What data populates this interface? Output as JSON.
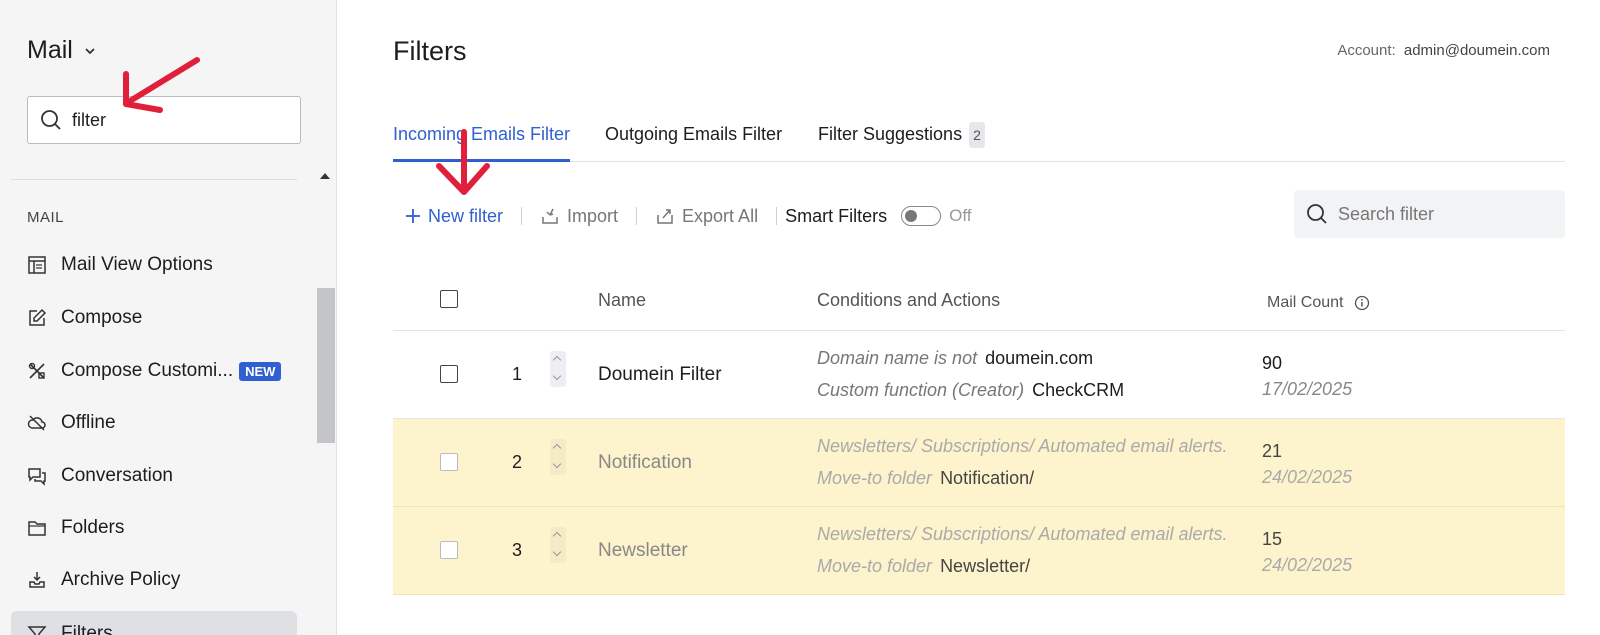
{
  "sidebar": {
    "app_title": "Mail",
    "search_value": "filter",
    "section_label": "MAIL",
    "items": [
      {
        "label": "Mail View Options"
      },
      {
        "label": "Compose"
      },
      {
        "label": "Compose Customi...",
        "badge": "NEW"
      },
      {
        "label": "Offline"
      },
      {
        "label": "Conversation"
      },
      {
        "label": "Folders"
      },
      {
        "label": "Archive Policy"
      },
      {
        "label": "Filters"
      }
    ]
  },
  "header": {
    "title": "Filters",
    "account_label": "Account:",
    "account_email": "admin@doumein.com"
  },
  "tabs": [
    {
      "label": "Incoming Emails Filter",
      "active": true
    },
    {
      "label": "Outgoing Emails Filter"
    },
    {
      "label": "Filter Suggestions",
      "count": "2"
    }
  ],
  "toolbar": {
    "new_filter": "New filter",
    "import": "Import",
    "export_all": "Export All",
    "smart_filters": "Smart Filters",
    "smart_state": "Off",
    "search_placeholder": "Search filter"
  },
  "table": {
    "columns": {
      "name": "Name",
      "conditions": "Conditions and Actions",
      "mail_count": "Mail Count"
    },
    "rows": [
      {
        "num": "1",
        "name": "Doumein Filter",
        "line1_label": "Domain name is not",
        "line1_value": "doumein.com",
        "line2_label": "Custom function (Creator)",
        "line2_value": "CheckCRM",
        "count": "90",
        "date": "17/02/2025",
        "enabled": true
      },
      {
        "num": "2",
        "name": "Notification",
        "line1_label": "Newsletters/ Subscriptions/ Automated email alerts.",
        "line1_value": "",
        "line2_label": "Move-to folder",
        "line2_value": "Notification/",
        "count": "21",
        "date": "24/02/2025",
        "enabled": false
      },
      {
        "num": "3",
        "name": "Newsletter",
        "line1_label": "Newsletters/ Subscriptions/ Automated email alerts.",
        "line1_value": "",
        "line2_label": "Move-to folder",
        "line2_value": "Newsletter/",
        "count": "15",
        "date": "24/02/2025",
        "enabled": false
      }
    ]
  },
  "colors": {
    "accent": "#2f5fd0",
    "disabled_row": "#fdf3cc",
    "annotation": "#e0203a"
  }
}
